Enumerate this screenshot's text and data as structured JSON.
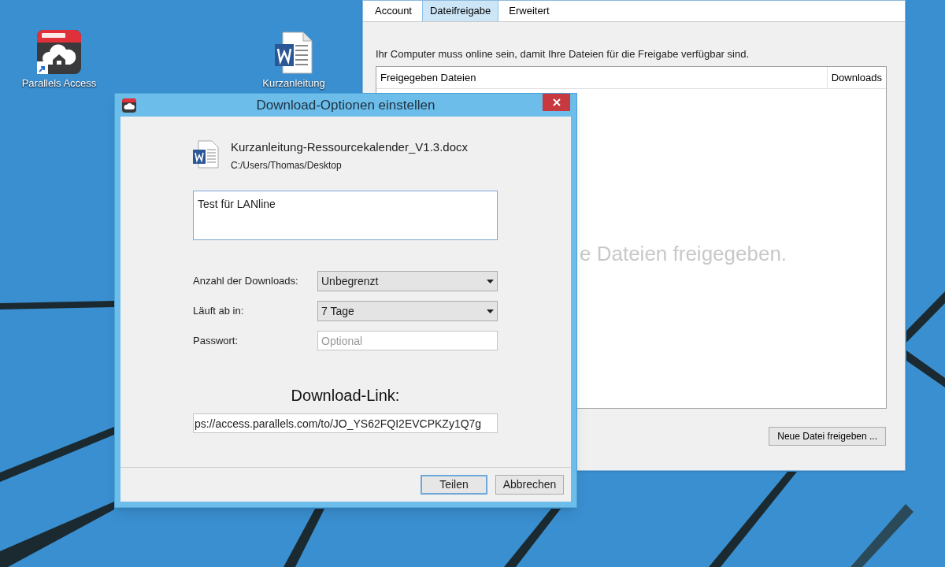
{
  "desktop": {
    "icons": [
      {
        "label": "Parallels Access",
        "kind": "app"
      },
      {
        "label": "Kurzanleitung",
        "kind": "document"
      }
    ]
  },
  "settings_window": {
    "tabs": [
      {
        "label": "Account",
        "selected": false
      },
      {
        "label": "Dateifreigabe",
        "selected": true
      },
      {
        "label": "Erweitert",
        "selected": false
      }
    ],
    "notice": "Ihr Computer muss online sein, damit Ihre Dateien für die Freigabe verfügbar sind.",
    "table": {
      "columns": [
        "Freigegeben Dateien",
        "Downloads"
      ],
      "empty_message": "e Dateien freigegeben."
    },
    "button": "Neue Datei freigeben ..."
  },
  "dialog": {
    "title": "Download-Optionen einstellen",
    "file": {
      "name": "Kurzanleitung-Ressourcekalender_V1.3.docx",
      "path": "C:/Users/Thomas/Desktop"
    },
    "note": {
      "value": "Test für LANline"
    },
    "fields": [
      {
        "label": "Anzahl der Downloads:",
        "kind": "select",
        "value": "Unbegrenzt"
      },
      {
        "label": "Läuft ab in:",
        "kind": "select",
        "value": "7 Tage"
      },
      {
        "label": "Passwort:",
        "kind": "input",
        "placeholder": "Optional"
      }
    ],
    "link_heading": "Download-Link:",
    "link": {
      "value": "ps://access.parallels.com/to/JO_YS62FQI2EVCPKZy1Q7g"
    },
    "buttons": [
      {
        "label": "Teilen",
        "default": true
      },
      {
        "label": "Abbrechen",
        "default": false
      }
    ]
  }
}
